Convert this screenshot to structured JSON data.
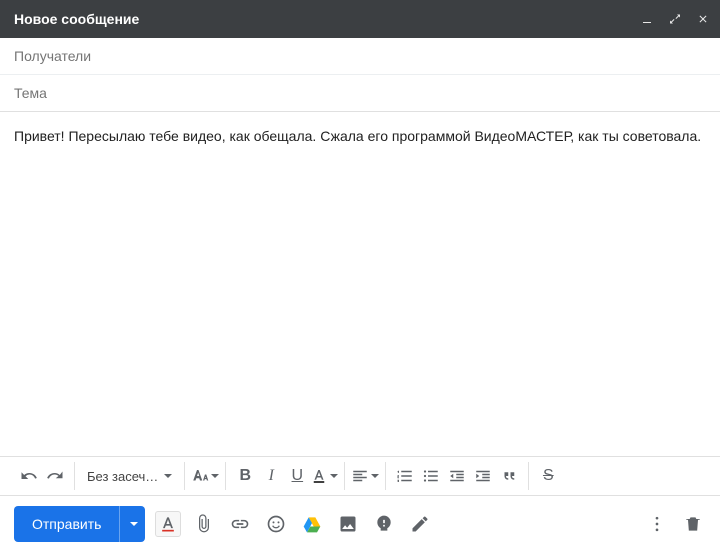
{
  "header": {
    "title": "Новое сообщение"
  },
  "fields": {
    "recipients_placeholder": "Получатели",
    "subject_placeholder": "Тема"
  },
  "body": {
    "text": "Привет! Пересылаю тебе видео, как обещала. Сжала его программой ВидеоМАСТЕР, как ты советовала."
  },
  "format_toolbar": {
    "font_family": "Без засеч…"
  },
  "send": {
    "label": "Отправить"
  }
}
